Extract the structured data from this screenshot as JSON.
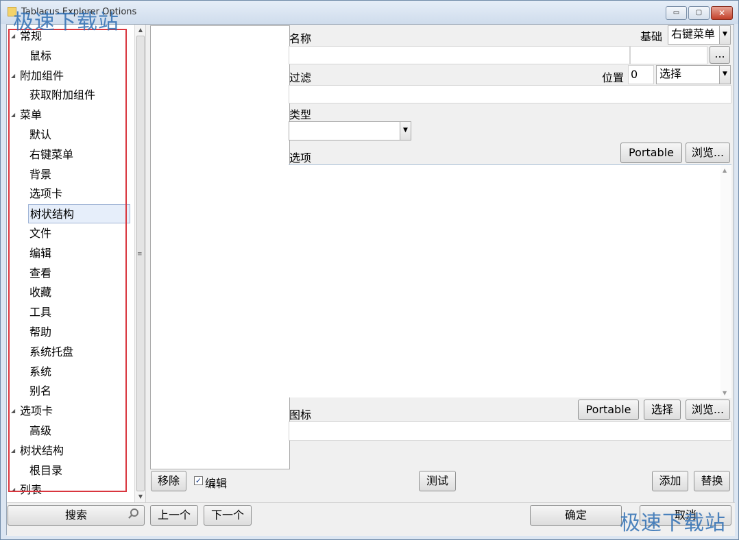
{
  "window": {
    "title": "Tablacus Explorer Options",
    "min_glyph": "▭",
    "max_glyph": "▢",
    "close_glyph": "✕"
  },
  "tree": {
    "items": [
      {
        "label": "常规",
        "level": 0
      },
      {
        "label": "鼠标",
        "level": 1
      },
      {
        "label": "附加组件",
        "level": 0
      },
      {
        "label": "获取附加组件",
        "level": 1
      },
      {
        "label": "菜单",
        "level": 0
      },
      {
        "label": "默认",
        "level": 1
      },
      {
        "label": "右键菜单",
        "level": 1
      },
      {
        "label": "背景",
        "level": 1
      },
      {
        "label": "选项卡",
        "level": 1
      },
      {
        "label": "树状结构",
        "level": 1,
        "selected": true
      },
      {
        "label": "文件",
        "level": 1
      },
      {
        "label": "编辑",
        "level": 1
      },
      {
        "label": "查看",
        "level": 1
      },
      {
        "label": "收藏",
        "level": 1
      },
      {
        "label": "工具",
        "level": 1
      },
      {
        "label": "帮助",
        "level": 1
      },
      {
        "label": "系统托盘",
        "level": 1
      },
      {
        "label": "系统",
        "level": 1
      },
      {
        "label": "别名",
        "level": 1
      },
      {
        "label": "选项卡",
        "level": 0
      },
      {
        "label": "高级",
        "level": 1
      },
      {
        "label": "树状结构",
        "level": 0
      },
      {
        "label": "根目录",
        "level": 1
      },
      {
        "label": "列表",
        "level": 0
      }
    ],
    "expand_glyph": "◢"
  },
  "form": {
    "name_label": "名称",
    "base_label": "基础",
    "base_value": "右键菜单",
    "ellipsis_label": "...",
    "filter_label": "过滤",
    "position_label": "位置",
    "position_value": "0",
    "select_combo_value": "选择",
    "type_label": "类型",
    "options_label": "选项",
    "portable_label": "Portable",
    "browse_label": "浏览...",
    "icon_label": "图标",
    "icon_select_label": "选择",
    "remove_label": "移除",
    "edit_check_label": "编辑",
    "test_label": "测试",
    "add_label": "添加",
    "replace_label": "替换"
  },
  "bottom": {
    "search_label": "搜索",
    "prev_label": "上一个",
    "next_label": "下一个",
    "ok_label": "确定",
    "cancel_label": "取消"
  },
  "watermark": "极速下载站"
}
